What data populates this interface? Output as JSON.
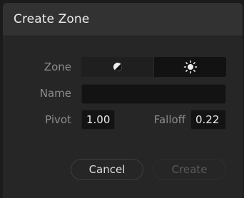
{
  "dialog": {
    "title": "Create Zone"
  },
  "zone": {
    "label": "Zone",
    "options": [
      {
        "icon": "half-circle-contrast-icon",
        "selected": true
      },
      {
        "icon": "sun-brightness-icon",
        "selected": false
      }
    ]
  },
  "name": {
    "label": "Name",
    "value": ""
  },
  "pivot": {
    "label": "Pivot",
    "value": "1.00"
  },
  "falloff": {
    "label": "Falloff",
    "value": "0.22"
  },
  "actions": {
    "cancel_label": "Cancel",
    "create_label": "Create",
    "create_enabled": false
  },
  "colors": {
    "dialog_bg": "#262627",
    "titlebar_bg": "#323233",
    "field_bg": "#131314",
    "label_text": "#8d8d8f",
    "primary_text": "#ececec",
    "disabled_text": "#5a5a5c"
  }
}
